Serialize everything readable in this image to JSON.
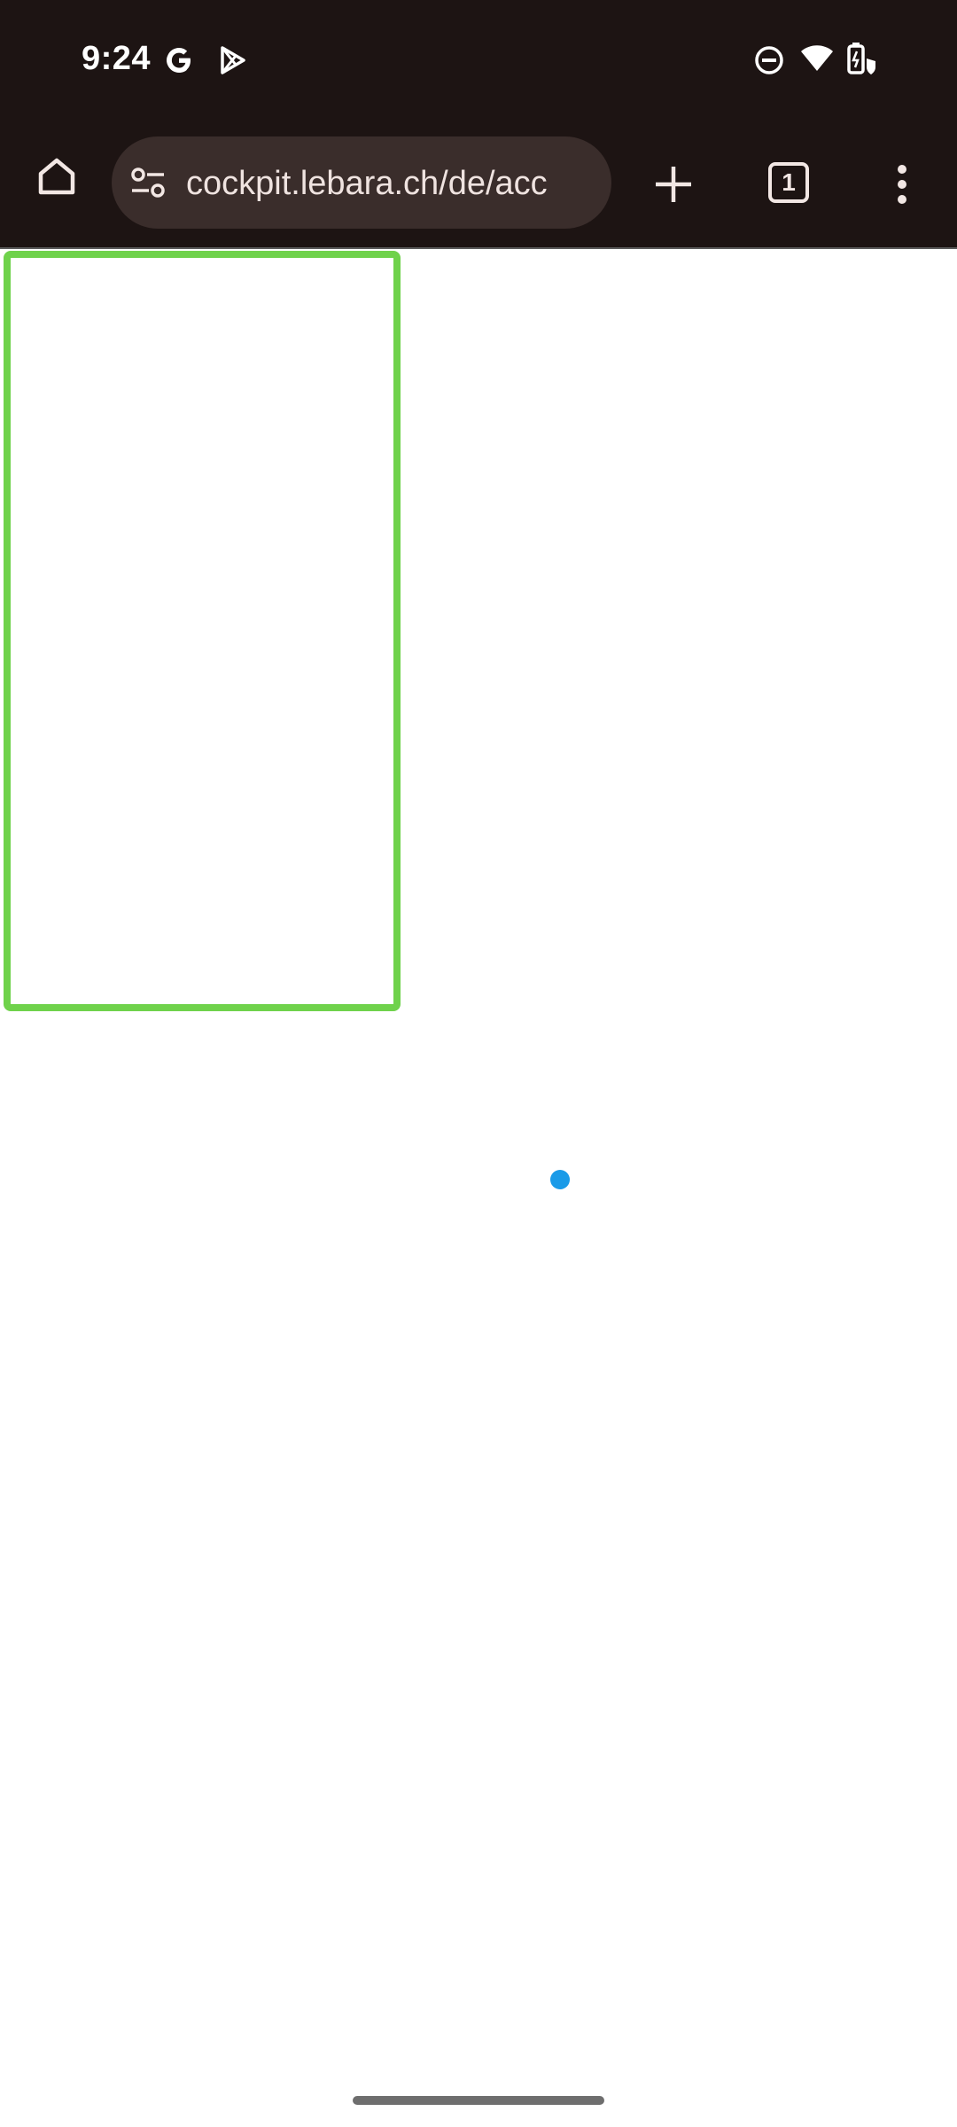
{
  "status_bar": {
    "time": "9:24",
    "left_icons": [
      "google-g-icon",
      "play-store-icon"
    ],
    "right_icons": [
      "do-not-disturb-icon",
      "wifi-icon",
      "battery-saver-icon"
    ]
  },
  "browser": {
    "url": "cockpit.lebara.ch/de/acc",
    "tab_count": "1",
    "buttons": [
      "home-icon",
      "site-settings-icon",
      "new-tab-icon",
      "tab-switcher-icon",
      "overflow-menu-icon"
    ]
  },
  "page": {
    "state": "loading"
  },
  "colors": {
    "chrome_background": "#1d1413",
    "url_pill": "#3a2d2b",
    "highlight_frame": "#6fd24b",
    "loading_dot": "#1a9be8",
    "page_background": "#ffffff"
  }
}
